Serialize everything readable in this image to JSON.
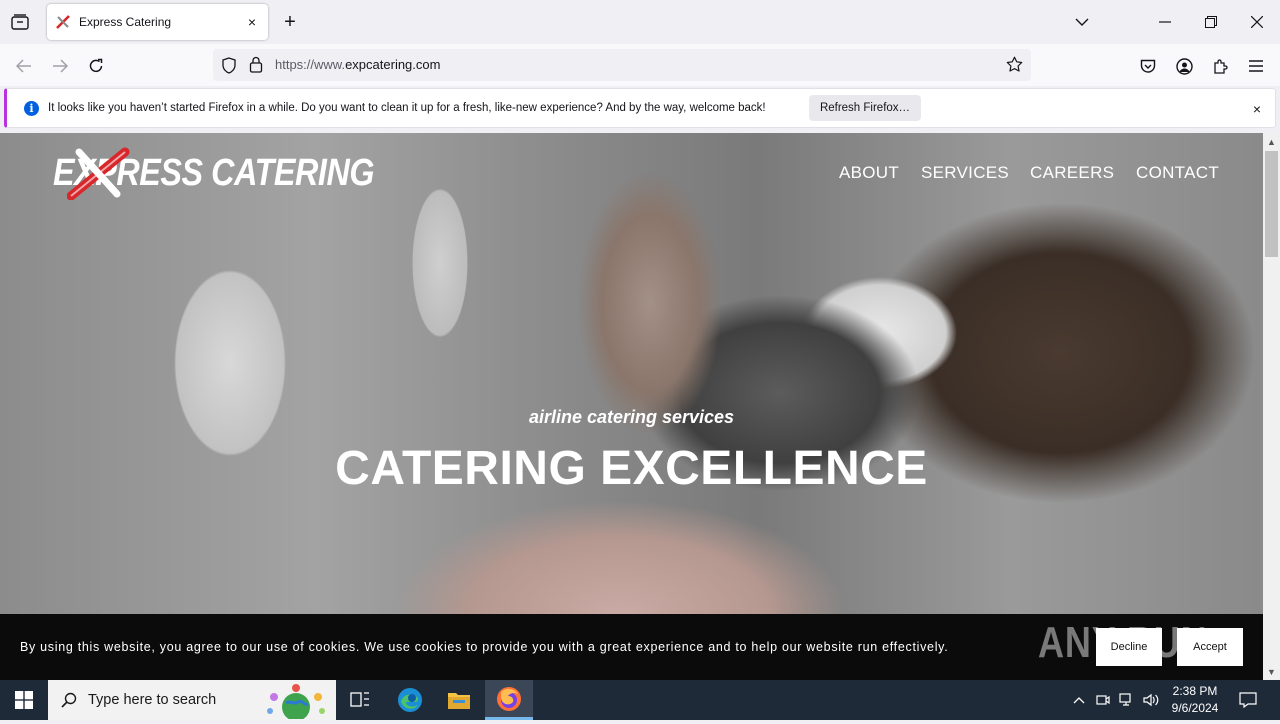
{
  "browser": {
    "tab": {
      "title": "Express Catering",
      "close": "×"
    },
    "new_tab": "+",
    "url": {
      "prefix": "https://www.",
      "host": "expcatering.com"
    }
  },
  "notification": {
    "message": "It looks like you haven’t started Firefox in a while. Do you want to clean it up for a fresh, like-new experience? And by the way, welcome back!",
    "button": "Refresh Firefox…",
    "close": "×",
    "icon": "i"
  },
  "site": {
    "logo_text": "EXPRESS CATERING",
    "nav": [
      "ABOUT",
      "SERVICES",
      "CAREERS",
      "CONTACT"
    ],
    "hero": {
      "subtitle": "airline catering services",
      "title": "CATERING EXCELLENCE"
    },
    "cookie": {
      "text": "By using this website, you agree to our use of cookies. We use cookies to provide you with a great experience and to help our website run effectively.",
      "decline": "Decline",
      "accept": "Accept"
    },
    "watermark": "ANY RUN"
  },
  "taskbar": {
    "search_placeholder": "Type here to search",
    "time": "2:38 PM",
    "date": "9/6/2024"
  },
  "colors": {
    "brand_red": "#d9262b",
    "notice_accent": "#b833e1",
    "info_blue": "#0060df"
  }
}
